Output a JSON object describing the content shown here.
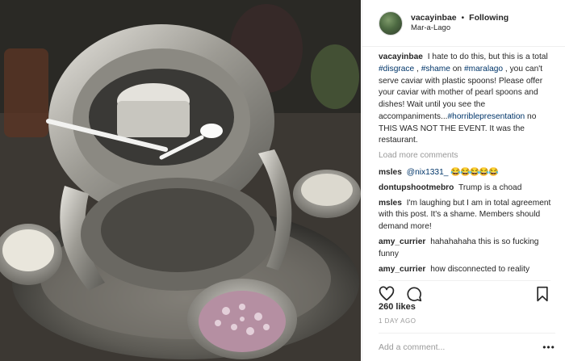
{
  "post": {
    "username": "vacayinbae",
    "separator": "•",
    "follow_label": "Following",
    "location": "Mar-a-Lago"
  },
  "caption": {
    "author": "vacayinbae",
    "part1": " I hate to do this, but this is a total ",
    "tag1": "#disgrace",
    "part2": " , ",
    "tag2": "#shame",
    "part3": " on ",
    "tag3": "#maralago",
    "part4": " , you can't serve caviar with plastic spoons! Please offer your caviar with mother of pearl spoons and dishes! Wait until you see the accompaniments...",
    "tag4": "#horriblepresentation",
    "part5": " no THIS WAS NOT THE EVENT. It was the restaurant."
  },
  "load_more_label": "Load more comments",
  "comments": [
    {
      "author": "msles",
      "mention": "@nix1331_",
      "text": "",
      "emoji": "😂😂😂😂😂"
    },
    {
      "author": "dontupshootmebro",
      "text": "Trump is a choad"
    },
    {
      "author": "msles",
      "text": "I'm laughing but I am in total agreement with this post. It's a shame. Members should demand more!"
    },
    {
      "author": "amy_currier",
      "text": "hahahahaha this is so fucking funny"
    },
    {
      "author": "amy_currier",
      "text": "how disconnected to reality"
    }
  ],
  "likes_label": "260 likes",
  "time_label": "1 DAY AGO",
  "add_comment_placeholder": "Add a comment...",
  "more_label": "•••",
  "icons": {
    "like": "heart-icon",
    "comment": "speech-bubble-icon",
    "save": "bookmark-icon",
    "more": "ellipsis-icon"
  },
  "colors": {
    "hashtag": "#003569",
    "muted": "#999999",
    "text": "#262626",
    "divider": "#efefef"
  }
}
